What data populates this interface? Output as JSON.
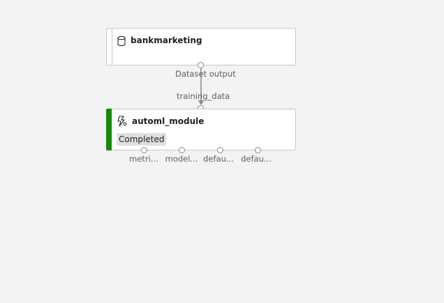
{
  "dataset_node": {
    "icon": "database-icon",
    "title": "bankmarketing",
    "output_port_label": "Dataset output"
  },
  "module_node": {
    "icon": "automl-icon",
    "title": "automl_module",
    "status": "Completed",
    "status_color": "#138a00",
    "input_port_label": "training_data",
    "output_ports": [
      "metri...",
      "model...",
      "defau...",
      "defau..."
    ]
  },
  "colors": {
    "canvas": "#f3f3f3",
    "node_border": "#c8c6c4",
    "edge": "#8a8886"
  }
}
